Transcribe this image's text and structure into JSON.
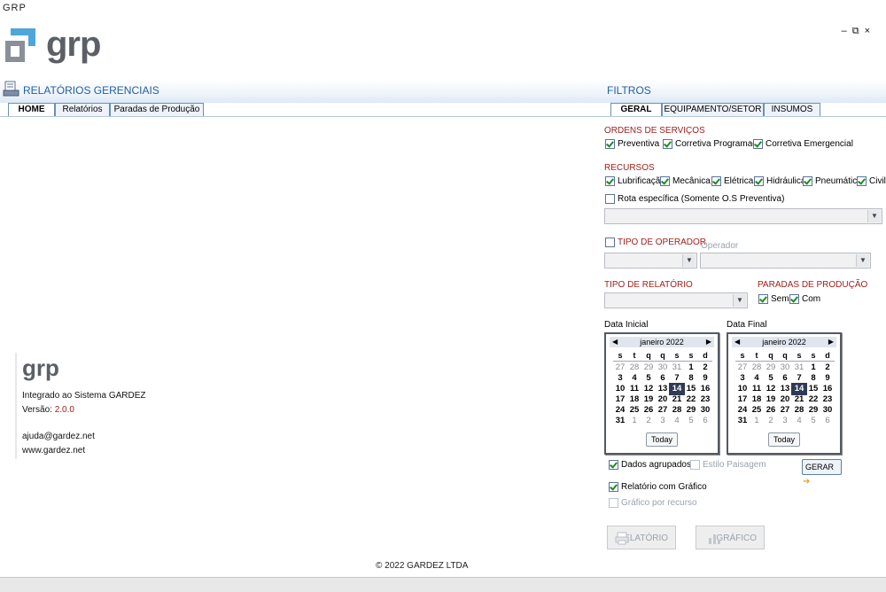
{
  "window": {
    "title": "GRP",
    "minimize": "–",
    "restore": "⧉",
    "close": "×"
  },
  "brand": {
    "logo_text": "grp",
    "accent": "#4fa6d8",
    "gray": "#8a9099"
  },
  "left_panel": {
    "title": "RELATÓRIOS GERENCIAIS",
    "tabs": [
      "HOME",
      "Relatórios",
      "Paradas de Produção"
    ],
    "active_tab": "HOME",
    "about": {
      "logo_text": "grp",
      "integrated": "Integrado ao Sistema GARDEZ",
      "version_label": "Versão:",
      "version": "2.0.0",
      "email": "ajuda@gardez.net",
      "site": "www.gardez.net"
    },
    "footer": "© 2022 GARDEZ LTDA"
  },
  "filters": {
    "title": "FILTROS",
    "tabs": [
      "GERAL",
      "EQUIPAMENTO/SETOR",
      "INSUMOS"
    ],
    "active_tab": "GERAL",
    "ordens": {
      "heading": "ORDENS DE SERVIÇOS",
      "items": [
        {
          "label": "Preventiva",
          "checked": true
        },
        {
          "label": "Corretiva Programada",
          "checked": true
        },
        {
          "label": "Corretiva Emergencial",
          "checked": true
        }
      ]
    },
    "recursos": {
      "heading": "RECURSOS",
      "items": [
        {
          "label": "Lubrificação",
          "checked": true
        },
        {
          "label": "Mecânica",
          "checked": true
        },
        {
          "label": "Elétrica",
          "checked": true
        },
        {
          "label": "Hidráulica",
          "checked": true
        },
        {
          "label": "Pneumática",
          "checked": true
        },
        {
          "label": "Civil",
          "checked": true
        }
      ],
      "rota_label": "Rota específica  (Somente O.S Preventiva)",
      "rota_checked": false,
      "rota_select_value": ""
    },
    "tipo_operador": {
      "label": "TIPO DE OPERADOR",
      "checked": false,
      "select_value": ""
    },
    "operador": {
      "label": "Operador",
      "select_value": ""
    },
    "tipo_relatorio": {
      "heading": "TIPO DE RELATÓRIO",
      "select_value": ""
    },
    "paradas": {
      "heading": "PARADAS DE PRODUÇÃO",
      "items": [
        {
          "label": "Sem",
          "checked": true
        },
        {
          "label": "Com",
          "checked": true
        }
      ]
    },
    "data_inicial": {
      "label": "Data Inicial",
      "month": "janeiro 2022",
      "dow": [
        "s",
        "t",
        "q",
        "q",
        "s",
        "s",
        "d"
      ],
      "weeks": [
        [
          "27",
          "28",
          "29",
          "30",
          "31",
          "1",
          "2"
        ],
        [
          "3",
          "4",
          "5",
          "6",
          "7",
          "8",
          "9"
        ],
        [
          "10",
          "11",
          "12",
          "13",
          "14",
          "15",
          "16"
        ],
        [
          "17",
          "18",
          "19",
          "20",
          "21",
          "22",
          "23"
        ],
        [
          "24",
          "25",
          "26",
          "27",
          "28",
          "29",
          "30"
        ],
        [
          "31",
          "1",
          "2",
          "3",
          "4",
          "5",
          "6"
        ]
      ],
      "selected": "14",
      "today_label": "Today"
    },
    "data_final": {
      "label": "Data Final",
      "month": "janeiro 2022",
      "dow": [
        "s",
        "t",
        "q",
        "q",
        "s",
        "s",
        "d"
      ],
      "weeks": [
        [
          "27",
          "28",
          "29",
          "30",
          "31",
          "1",
          "2"
        ],
        [
          "3",
          "4",
          "5",
          "6",
          "7",
          "8",
          "9"
        ],
        [
          "10",
          "11",
          "12",
          "13",
          "14",
          "15",
          "16"
        ],
        [
          "17",
          "18",
          "19",
          "20",
          "21",
          "22",
          "23"
        ],
        [
          "24",
          "25",
          "26",
          "27",
          "28",
          "29",
          "30"
        ],
        [
          "31",
          "1",
          "2",
          "3",
          "4",
          "5",
          "6"
        ]
      ],
      "selected": "14",
      "today_label": "Today"
    },
    "options": {
      "dados_agrupados": {
        "label": "Dados agrupados",
        "checked": true
      },
      "estilo_paisagem": {
        "label": "Estilo Paisagem",
        "checked": false
      },
      "relatorio_grafico": {
        "label": "Relatório com Gráfico",
        "checked": true
      },
      "grafico_recurso": {
        "label": "Gráfico por recurso",
        "checked": false
      }
    },
    "buttons": {
      "gerar": "GERAR",
      "relatorio": "RELATÓRIO",
      "grafico": "GRÁFICO"
    }
  }
}
